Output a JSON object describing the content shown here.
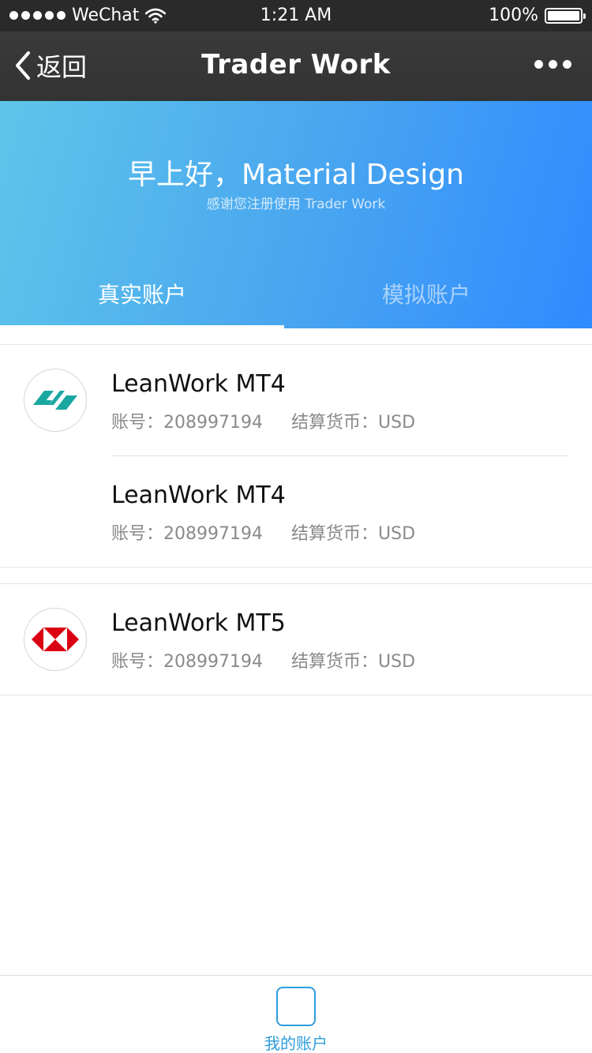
{
  "status_bar": {
    "carrier": "WeChat",
    "time": "1:21 AM",
    "battery": "100%",
    "battery_level": 1.0
  },
  "nav": {
    "back_label": "返回",
    "title": "Trader Work",
    "more_icon": "more-dots-icon"
  },
  "hero": {
    "greeting": "早上好，Material Design",
    "subtitle": "感谢您注册使用 Trader Work",
    "gradient_start": "#5ec6ea",
    "gradient_end": "#2f8bff"
  },
  "tabs": [
    {
      "label": "真实账户",
      "active": true
    },
    {
      "label": "模拟账户",
      "active": false
    }
  ],
  "accounts": [
    {
      "name": "LeanWork MT4",
      "account_label": "账号：",
      "account_no": "208997194",
      "currency_label": "结算货币：",
      "currency": "USD",
      "logo": "leanwork-logo"
    },
    {
      "name": "LeanWork MT4",
      "account_label": "账号：",
      "account_no": "208997194",
      "currency_label": "结算货币：",
      "currency": "USD",
      "logo": ""
    },
    {
      "name": "LeanWork MT5",
      "account_label": "账号：",
      "account_no": "208997194",
      "currency_label": "结算货币：",
      "currency": "USD",
      "logo": "hsbc-style-logo"
    }
  ],
  "bottom_tab": {
    "label": "我的账户",
    "accent": "#2d9cdb"
  }
}
